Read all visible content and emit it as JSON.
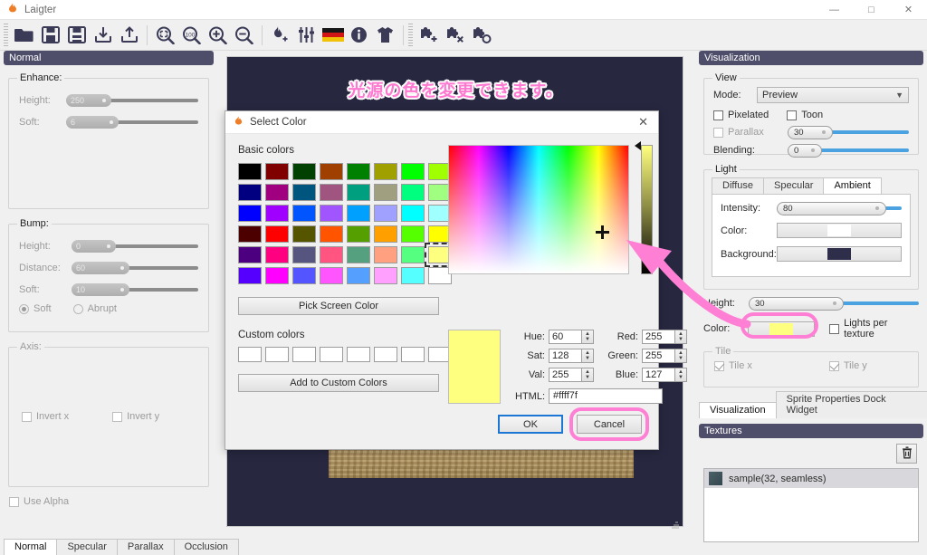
{
  "window": {
    "title": "Laigter",
    "minimize": "—",
    "maximize": "□",
    "close": "✕"
  },
  "toolbar": {
    "items": [
      {
        "name": "open-folder-icon",
        "tip": "Open"
      },
      {
        "name": "save-icon",
        "tip": "Save"
      },
      {
        "name": "save-as-icon",
        "tip": "Save As"
      },
      {
        "name": "import-icon",
        "tip": "Import"
      },
      {
        "name": "export-icon",
        "tip": "Export"
      },
      {
        "name": "zoom-fit-icon",
        "tip": "Fit"
      },
      {
        "name": "zoom-100-icon",
        "tip": "100%"
      },
      {
        "name": "zoom-in-icon",
        "tip": "Zoom In"
      },
      {
        "name": "zoom-out-icon",
        "tip": "Zoom Out"
      },
      {
        "name": "add-light-icon",
        "tip": "Add Light"
      },
      {
        "name": "settings-sliders-icon",
        "tip": "Settings"
      },
      {
        "name": "language-flag-icon",
        "tip": "Language"
      },
      {
        "name": "info-icon",
        "tip": "About"
      },
      {
        "name": "shirt-icon",
        "tip": "Theme"
      },
      {
        "name": "add-plugin-icon",
        "tip": "Add Plugin"
      },
      {
        "name": "remove-plugin-icon",
        "tip": "Remove Plugin"
      },
      {
        "name": "configure-plugin-icon",
        "tip": "Configure Plugin"
      }
    ]
  },
  "left_panel": {
    "dock_title": "Normal",
    "enhance": {
      "title": "Enhance:",
      "height_label": "Height:",
      "height_value": "250",
      "height_pct": 34,
      "soft_label": "Soft:",
      "soft_value": "6",
      "soft_pct": 40
    },
    "bump": {
      "title": "Bump:",
      "height_label": "Height:",
      "height_value": "0",
      "height_pct": 35,
      "distance_label": "Distance:",
      "distance_value": "60",
      "distance_pct": 46,
      "soft_label": "Soft:",
      "soft_value": "10",
      "soft_pct": 46,
      "radio_soft": "Soft",
      "radio_abrupt": "Abrupt",
      "radio_selected": "Soft"
    },
    "axis": {
      "title": "Axis:",
      "invert_x": "Invert x",
      "invert_x_checked": false,
      "invert_y": "Invert y",
      "invert_y_checked": false
    },
    "use_alpha": "Use Alpha",
    "use_alpha_checked": false,
    "tabs": [
      {
        "label": "Normal",
        "active": true
      },
      {
        "label": "Specular",
        "active": false
      },
      {
        "label": "Parallax",
        "active": false
      },
      {
        "label": "Occlusion",
        "active": false
      }
    ]
  },
  "preview": {
    "annotation": "光源の色を変更できます。",
    "background_color": "#272740",
    "sprite_name": "sample(32, seamless)"
  },
  "right_panel": {
    "dock_title": "Visualization",
    "view": {
      "title": "View",
      "mode_label": "Mode:",
      "mode_value": "Preview",
      "pixelated": "Pixelated",
      "pixelated_checked": false,
      "toon": "Toon",
      "toon_checked": false,
      "parallax": "Parallax",
      "parallax_checked": false,
      "parallax_value": "30",
      "parallax_pct": 37,
      "blending_label": "Blending:",
      "blending_value": "0",
      "blending_pct": 28
    },
    "light": {
      "title": "Light",
      "tabs": [
        {
          "label": "Diffuse",
          "active": false
        },
        {
          "label": "Specular",
          "active": false
        },
        {
          "label": "Ambient",
          "active": true
        }
      ],
      "intensity_label": "Intensity:",
      "intensity_value": "80",
      "intensity_pct": 88,
      "color_label": "Color:",
      "color_value": "#ffffff",
      "background_label": "Background:",
      "background_value": "#2e2e4a"
    },
    "height_label": "Height:",
    "height_value": "30",
    "height_pct": 56,
    "light_color_label": "Color:",
    "light_color_value": "#ffff7f",
    "lights_per_texture": "Lights per texture",
    "lights_per_texture_checked": false,
    "tile": {
      "title": "Tile",
      "tile_x": "Tile x",
      "tile_x_checked": true,
      "tile_y": "Tile y",
      "tile_y_checked": true
    },
    "bottom_tabs": [
      {
        "label": "Visualization",
        "active": true
      },
      {
        "label": "Sprite Properties Dock Widget",
        "active": false
      }
    ],
    "textures": {
      "dock_title": "Textures",
      "delete_icon": "trash-icon",
      "items": [
        "sample(32, seamless)"
      ]
    }
  },
  "color_dialog": {
    "title": "Select Color",
    "close": "✕",
    "basic_colors_label": "Basic colors",
    "basic_colors": [
      "#000000",
      "#800000",
      "#004000",
      "#a04000",
      "#008000",
      "#a0a000",
      "#00ff00",
      "#a0ff00",
      "#000080",
      "#a00080",
      "#00557f",
      "#a05580",
      "#009f7f",
      "#a0a080",
      "#00ff7f",
      "#a0ff80",
      "#0000ff",
      "#a000ff",
      "#0055ff",
      "#a055ff",
      "#00a0ff",
      "#a0a0ff",
      "#00ffff",
      "#a0ffff",
      "#4c0000",
      "#ff0000",
      "#555500",
      "#ff5500",
      "#55a000",
      "#ffa000",
      "#55ff00",
      "#ffff00",
      "#4c0080",
      "#ff0080",
      "#555580",
      "#ff5580",
      "#55a07f",
      "#ffa080",
      "#55ff7f",
      "#ffff7f",
      "#5500ff",
      "#ff00ff",
      "#5555ff",
      "#ff55ff",
      "#55a0ff",
      "#ffa0ff",
      "#55ffff",
      "#ffffff"
    ],
    "selected_index": 39,
    "pick_screen_color": "Pick Screen Color",
    "custom_colors_label": "Custom colors",
    "custom_colors_count": 16,
    "add_to_custom": "Add to Custom Colors",
    "preview_color": "#ffff7f",
    "fields": {
      "hue_label": "Hue:",
      "hue_value": "60",
      "sat_label": "Sat:",
      "sat_value": "128",
      "val_label": "Val:",
      "val_value": "255",
      "red_label": "Red:",
      "red_value": "255",
      "green_label": "Green:",
      "green_value": "255",
      "blue_label": "Blue:",
      "blue_value": "127",
      "html_label": "HTML:",
      "html_value": "#ffff7f"
    },
    "ok": "OK",
    "cancel": "Cancel"
  },
  "highlight_color": "#ff7fd4"
}
